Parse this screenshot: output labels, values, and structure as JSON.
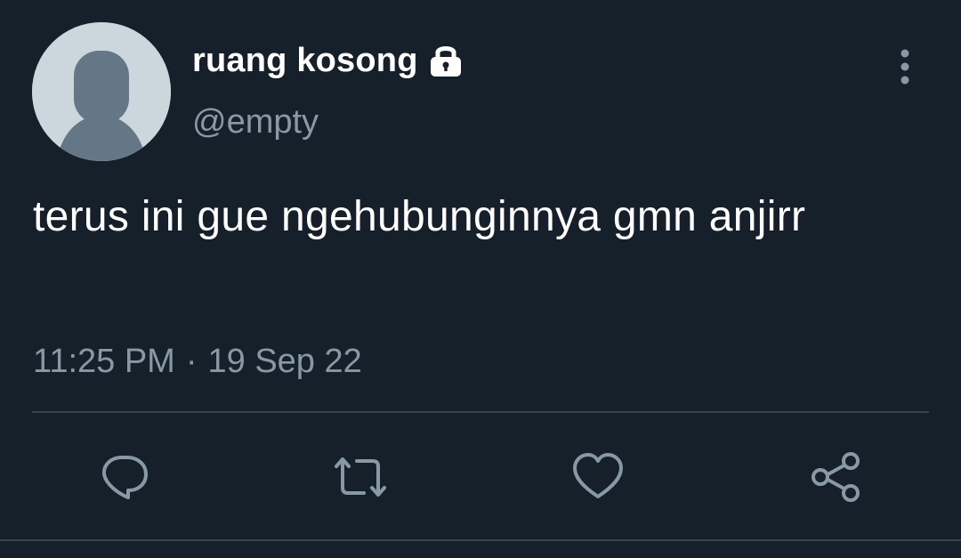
{
  "tweet": {
    "display_name": "ruang kosong",
    "handle": "@empty",
    "text": "terus ini gue ngehubunginnya gmn anjirr",
    "time": "11:25 PM",
    "separator": "·",
    "date": "19 Sep 22",
    "protected": true
  },
  "icons": {
    "lock": "lock-icon",
    "more": "more-vertical-icon",
    "reply": "reply-icon",
    "retweet": "retweet-icon",
    "like": "heart-icon",
    "share": "share-icon"
  },
  "colors": {
    "background": "#15202b",
    "text_primary": "#ffffff",
    "text_secondary": "#8899a6",
    "divider": "#38444d",
    "avatar_bg": "#ccd6dd",
    "avatar_fg": "#657786"
  }
}
